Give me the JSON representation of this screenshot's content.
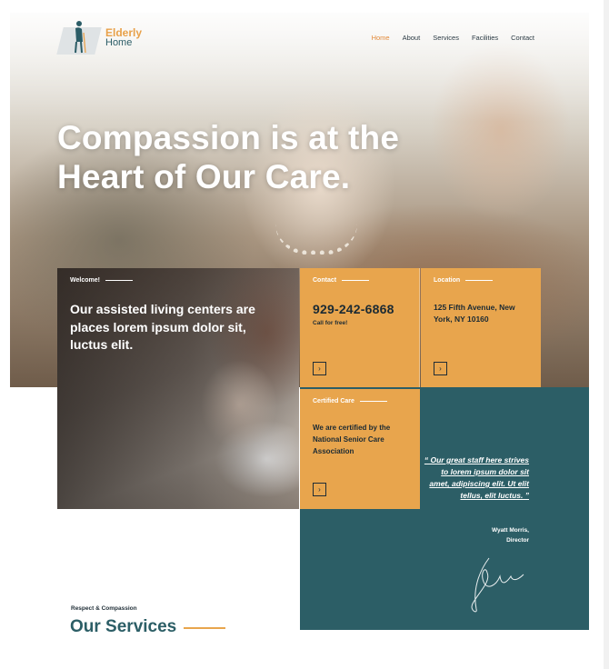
{
  "brand": {
    "name_line1": "Elderly",
    "name_line2": "Home"
  },
  "nav": {
    "items": [
      "Home",
      "About",
      "Services",
      "Facilities",
      "Contact"
    ],
    "active": "Home"
  },
  "hero": {
    "title_line1": "Compassion is at the",
    "title_line2": "Heart of Our Care."
  },
  "welcome": {
    "label": "Welcome!",
    "text": "Our assisted living centers are places lorem ipsum dolor sit, luctus elit."
  },
  "contact": {
    "label": "Contact",
    "phone": "929-242-6868",
    "subtext": "Call for free!",
    "arrow": "›"
  },
  "location": {
    "label": "Location",
    "address": "125 Fifth Avenue, New York, NY 10160",
    "arrow": "›"
  },
  "certified": {
    "label": "Certified Care",
    "text": "We are certified by the National Senior Care Association",
    "arrow": "›"
  },
  "testimonial": {
    "quote": "“ Our great staff here strives to lorem ipsum dolor sit amet, adipiscing elit. Ut elit tellus, elit luctus. ”",
    "author_name": "Wyatt Morris,",
    "author_role": "Director"
  },
  "services": {
    "eyebrow": "Respect & Compassion",
    "title": "Our Services"
  },
  "colors": {
    "accent_orange": "#e8a54d",
    "teal": "#2c5e66",
    "nav_active": "#e38a3a"
  }
}
